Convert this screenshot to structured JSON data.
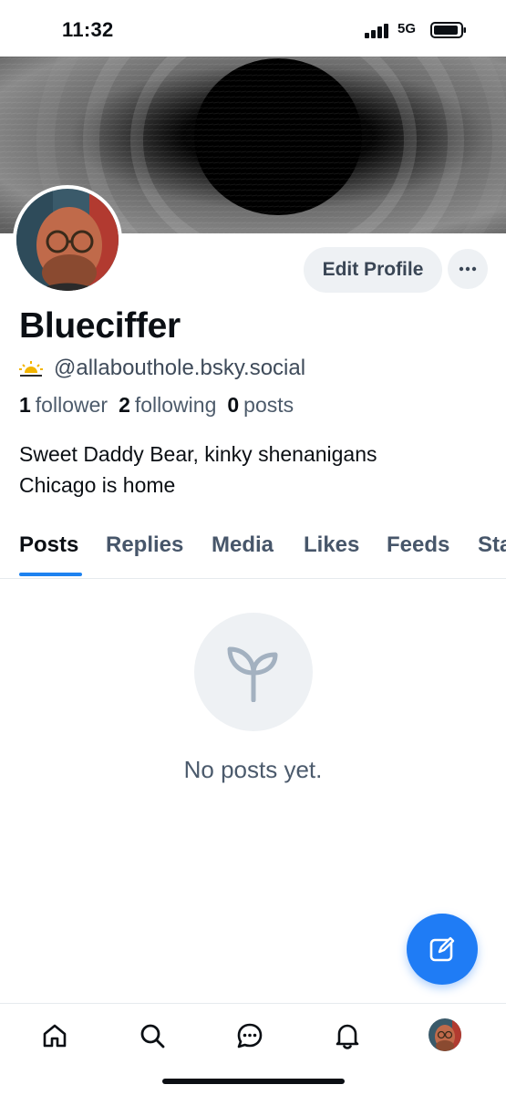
{
  "status_bar": {
    "time": "11:32",
    "network": "5G"
  },
  "profile": {
    "display_name": "Blueciffer",
    "handle": "@allabouthole.bsky.social",
    "handle_icon": "sunrise-icon",
    "stats": {
      "followers_count": "1",
      "followers_label": "follower",
      "following_count": "2",
      "following_label": "following",
      "posts_count": "0",
      "posts_label": "posts"
    },
    "bio_lines": [
      "Sweet Daddy Bear, kinky shenanigans",
      "Chicago is home"
    ]
  },
  "actions": {
    "edit_profile_label": "Edit Profile",
    "more_label": "···"
  },
  "tabs": [
    {
      "label": "Posts",
      "active": true
    },
    {
      "label": "Replies",
      "active": false
    },
    {
      "label": "Media",
      "active": false
    },
    {
      "label": "Likes",
      "active": false
    },
    {
      "label": "Feeds",
      "active": false
    },
    {
      "label": "Sta",
      "active": false
    }
  ],
  "empty_state": {
    "text": "No posts yet.",
    "icon": "sprout-icon"
  },
  "fab": {
    "icon": "compose-icon"
  },
  "bottom_nav": [
    "home-icon",
    "search-icon",
    "chat-icon",
    "bell-icon",
    "profile-avatar"
  ],
  "colors": {
    "accent": "#1d82f0",
    "fab": "#1f7cf5",
    "muted": "#4d5b6b"
  }
}
